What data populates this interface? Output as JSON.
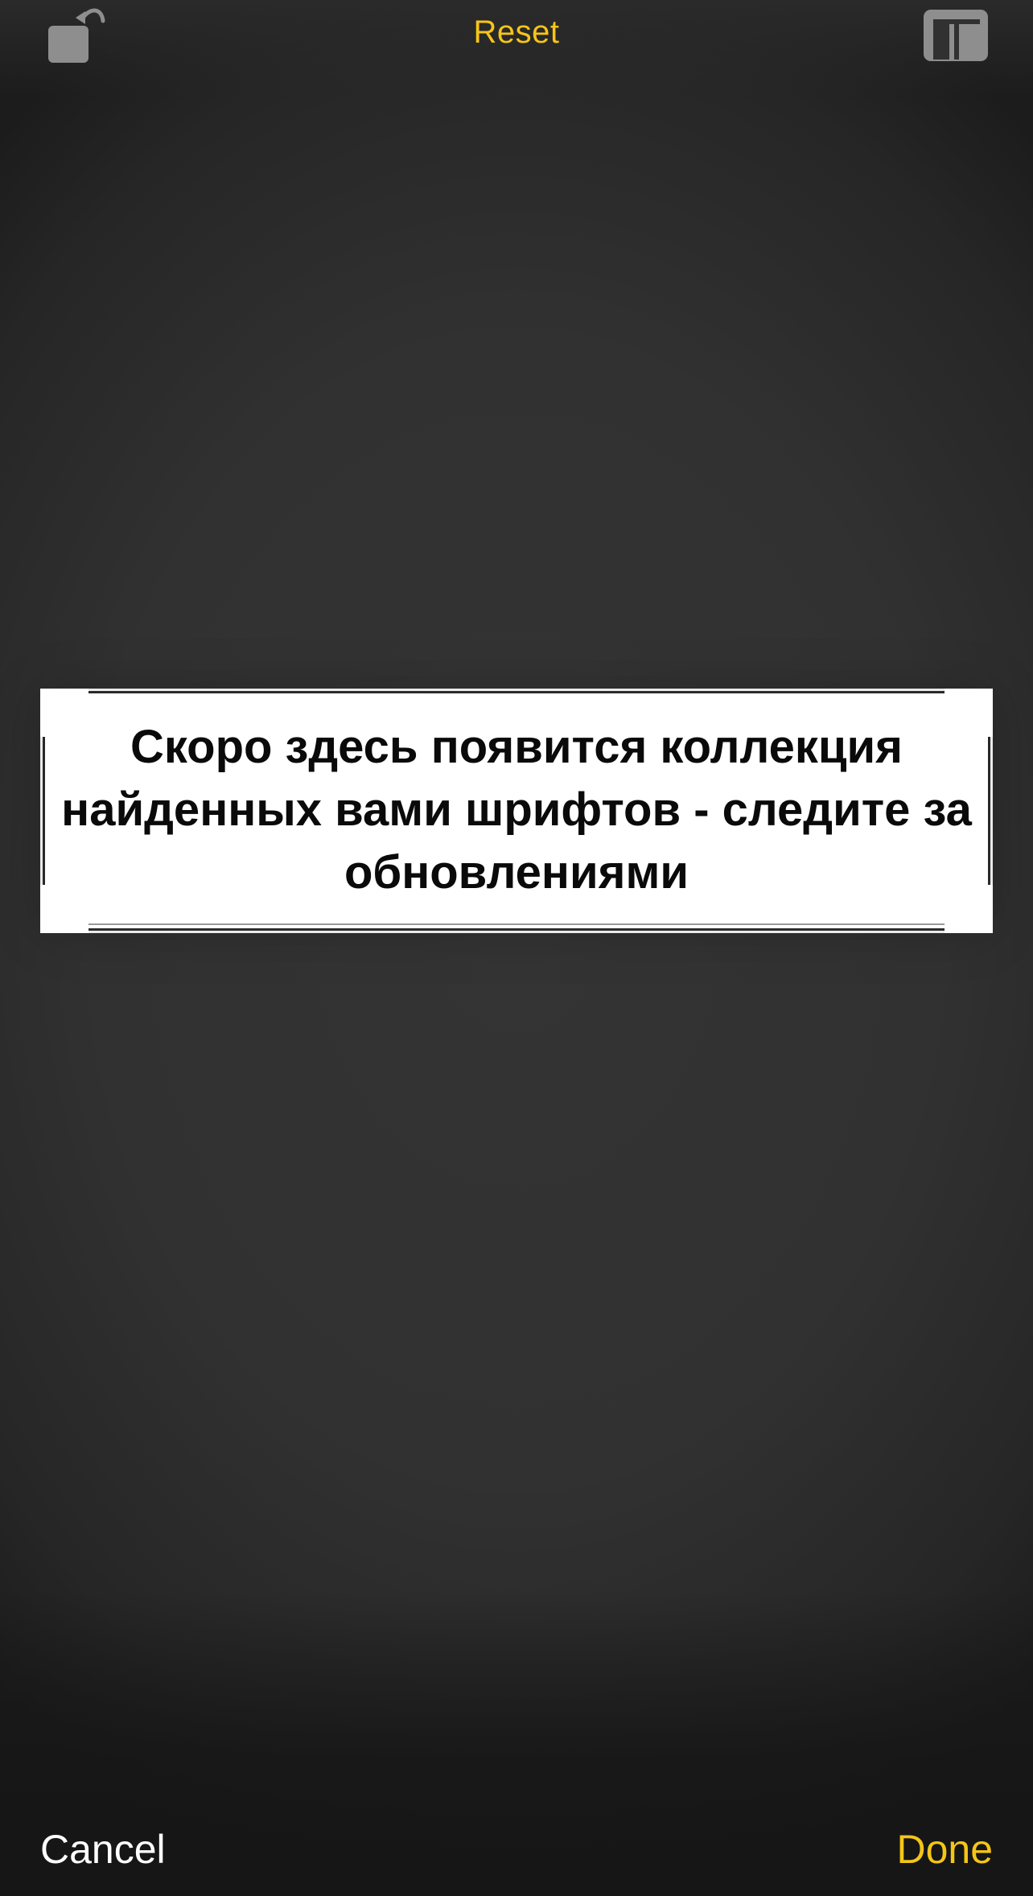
{
  "toolbar": {
    "reset_label": "Reset",
    "rotate_icon": "rotate-left-icon",
    "aspect_icon": "aspect-ratio-icon"
  },
  "crop": {
    "text": "Скоро здесь появится коллекция найденных вами шрифтов - следите за обновлениями"
  },
  "footer": {
    "cancel_label": "Cancel",
    "done_label": "Done"
  },
  "colors": {
    "accent": "#f5c518",
    "icon_gray": "#8e8e8e",
    "background": "#313131"
  }
}
